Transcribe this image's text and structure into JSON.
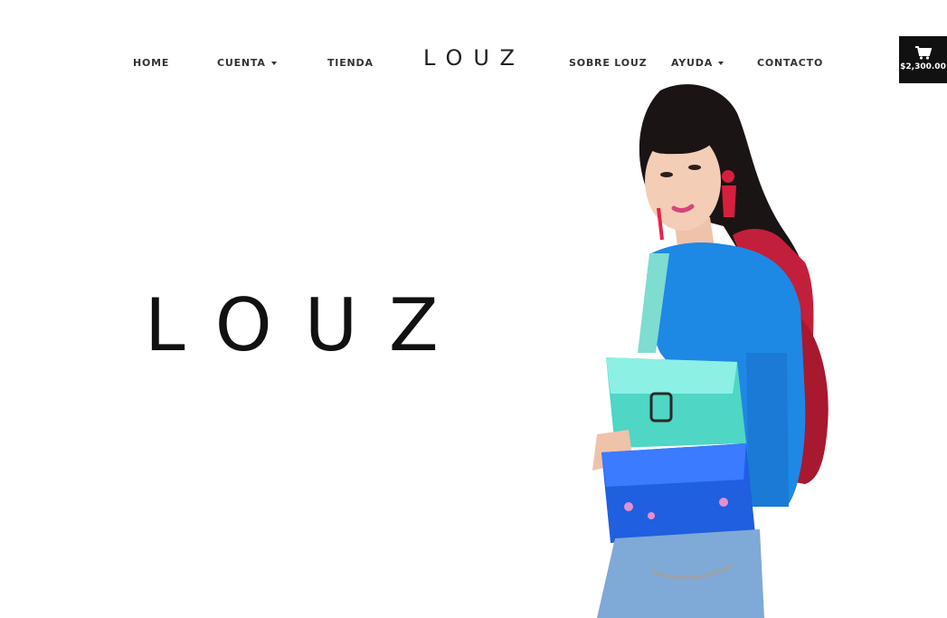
{
  "nav": {
    "home": "HOME",
    "cuenta": "CUENTA",
    "tienda": "TIENDA",
    "logo": "LOUZ",
    "sobre": "SOBRE LOUZ",
    "ayuda": "AYUDA",
    "contacto": "CONTACTO"
  },
  "cart": {
    "icon": "shopping-cart-icon",
    "total": "$2,300.00"
  },
  "hero": {
    "logo": "LOUZ"
  },
  "colors": {
    "cart_bg": "#111111",
    "sweater": "#1e88e5",
    "backpack": "#c21f3a",
    "bag_teal": "#4fd6c4",
    "bag_blue": "#1f5fe0",
    "jeans": "#7fa9d6"
  }
}
